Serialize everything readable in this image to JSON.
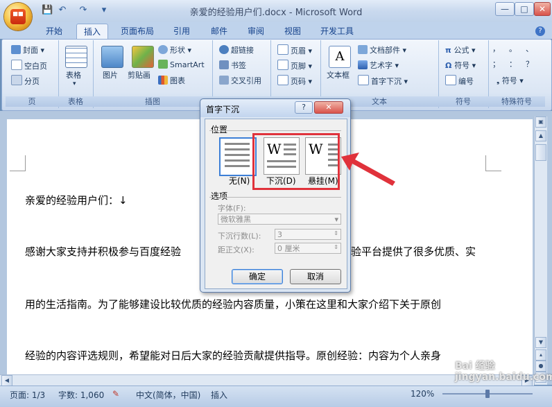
{
  "window": {
    "title": "亲爱的经验用户们.docx - Microsoft Word",
    "minimize": "—",
    "maximize": "□",
    "close": "✕",
    "help": "?"
  },
  "quick_access": {
    "save": "💾",
    "undo": "↶",
    "redo": "↷",
    "more": "▾"
  },
  "tabs": [
    "开始",
    "插入",
    "页面布局",
    "引用",
    "邮件",
    "审阅",
    "视图",
    "开发工具"
  ],
  "active_tab": "插入",
  "ribbon": {
    "pages": {
      "label": "页",
      "items": [
        "封面",
        "空白页",
        "分页"
      ]
    },
    "table": {
      "label": "表格",
      "button": "表格"
    },
    "illustrations": {
      "label": "插图",
      "items": [
        "图片",
        "剪贴画",
        "形状",
        "SmartArt",
        "图表"
      ]
    },
    "links": {
      "items": [
        "超链接",
        "书签",
        "交叉引用"
      ]
    },
    "header_footer": {
      "items": [
        "页眉",
        "页脚",
        "页码"
      ]
    },
    "text": {
      "label": "文本",
      "textbox": "文本框",
      "items": [
        "文档部件",
        "艺术字",
        "首字下沉"
      ]
    },
    "symbols": {
      "label": "符号",
      "items": [
        "公式",
        "符号",
        "编号"
      ]
    },
    "special_symbols": {
      "label": "特殊符号",
      "chars": [
        "，",
        "。",
        "、",
        "；",
        "：",
        "？"
      ],
      "more": "符号"
    }
  },
  "document": {
    "lines": [
      "亲爱的经验用户们：↓",
      "感谢大家支持并积极参与百度经验",
      "验平台提供了很多优质、实",
      "用的生活指南。为了能够建设比较优质的经验内容质量，小策在这里和大家介绍下关于原创",
      "经验的内容评选规则，希望能对日后大家的经验贡献提供指导。原创经验：内容为个人亲身"
    ]
  },
  "status_bar": {
    "page": "页面: 1/3",
    "words": "字数: 1,060",
    "language": "中文(简体，中国)",
    "mode": "插入",
    "zoom": "120%"
  },
  "dialog": {
    "title": "首字下沉",
    "help": "?",
    "close": "✕",
    "position_label": "位置",
    "options": [
      {
        "label": "无(N)",
        "selected": true
      },
      {
        "label": "下沉(D)",
        "selected": false
      },
      {
        "label": "悬挂(M)",
        "selected": false
      }
    ],
    "options_label": "选项",
    "font_label": "字体(F):",
    "font_value": "微软雅黑",
    "lines_label": "下沉行数(L):",
    "lines_value": "3",
    "distance_label": "距正文(X):",
    "distance_value": "0 厘米",
    "ok": "确定",
    "cancel": "取消"
  },
  "watermark": "Bai 经验\njingyan.baidu.com",
  "colors": {
    "accent": "#e0323b",
    "ribbon": "#dbe6f4",
    "title": "#c9d9ee"
  }
}
